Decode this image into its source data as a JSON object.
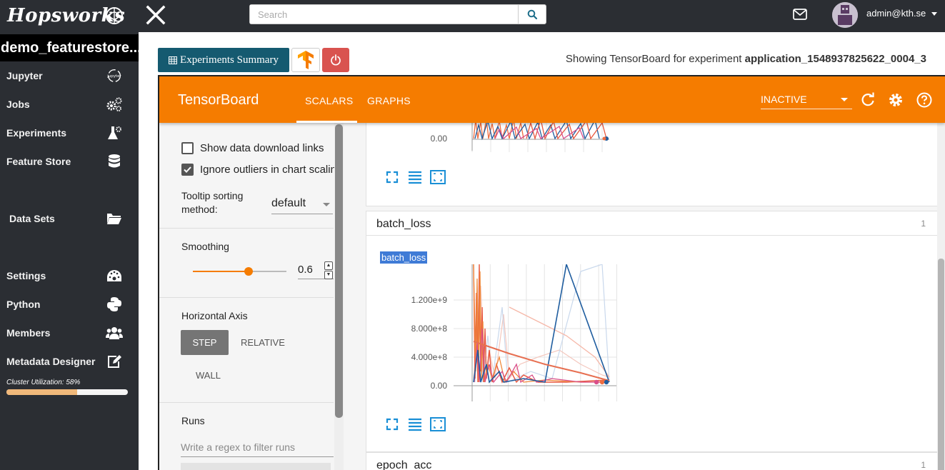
{
  "app": {
    "logo_text": "Hopsworks",
    "search_placeholder": "Search",
    "user": "admin@kth.se"
  },
  "sidebar": {
    "project": "demo_featurestore...",
    "items": [
      {
        "label": "Jupyter",
        "icon": "jupyter-icon"
      },
      {
        "label": "Jobs",
        "icon": "gears-icon"
      },
      {
        "label": "Experiments",
        "icon": "flask-icon"
      },
      {
        "label": "Feature Store",
        "icon": "database-icon"
      },
      {
        "label": "Data Sets",
        "icon": "folder-open-icon"
      },
      {
        "label": "Settings",
        "icon": "dashboard-icon"
      },
      {
        "label": "Python",
        "icon": "python-icon"
      },
      {
        "label": "Members",
        "icon": "users-icon"
      },
      {
        "label": "Metadata Designer",
        "icon": "edit-icon"
      }
    ],
    "cluster_label": "Cluster Utilization: 58%",
    "cluster_utilization": 0.58
  },
  "actions": {
    "summary_label": "Experiments Summary",
    "showing_prefix": "Showing TensorBoard for experiment",
    "experiment_id": "application_1548937825622_0004_3"
  },
  "tensorboard": {
    "title": "TensorBoard",
    "tabs": [
      "SCALARS",
      "GRAPHS"
    ],
    "active_tab": "SCALARS",
    "run_state": "INACTIVE",
    "accent": "#f57c00",
    "settings": {
      "show_download_links": "Show data download links",
      "ignore_outliers": "Ignore outliers in chart scaling",
      "show_download_checked": false,
      "ignore_outliers_checked": true,
      "tooltip_sort_label_1": "Tooltip sorting",
      "tooltip_sort_label_2": "method:",
      "tooltip_sort_value": "default",
      "smoothing_label": "Smoothing",
      "smoothing_value": "0.6",
      "smoothing_fraction": 0.6,
      "horizontal_axis_label": "Horizontal Axis",
      "axis_options": [
        "STEP",
        "RELATIVE",
        "WALL"
      ],
      "axis_selected": "STEP",
      "runs_label": "Runs",
      "runs_filter_placeholder": "Write a regex to filter runs"
    },
    "groups": [
      {
        "name": "batch_loss",
        "count": "1",
        "chart_title": "batch_loss"
      },
      {
        "name": "epoch_acc",
        "count": "1"
      }
    ],
    "top_chart_tick": "0.00"
  },
  "chart_data": {
    "type": "line",
    "title": "batch_loss",
    "xlabel": "",
    "ylabel": "",
    "y_ticks": [
      "0.00",
      "4.000e+8",
      "8.000e+8",
      "1.200e+9"
    ],
    "ylim": [
      0,
      1600000000
    ],
    "grid": true
  }
}
